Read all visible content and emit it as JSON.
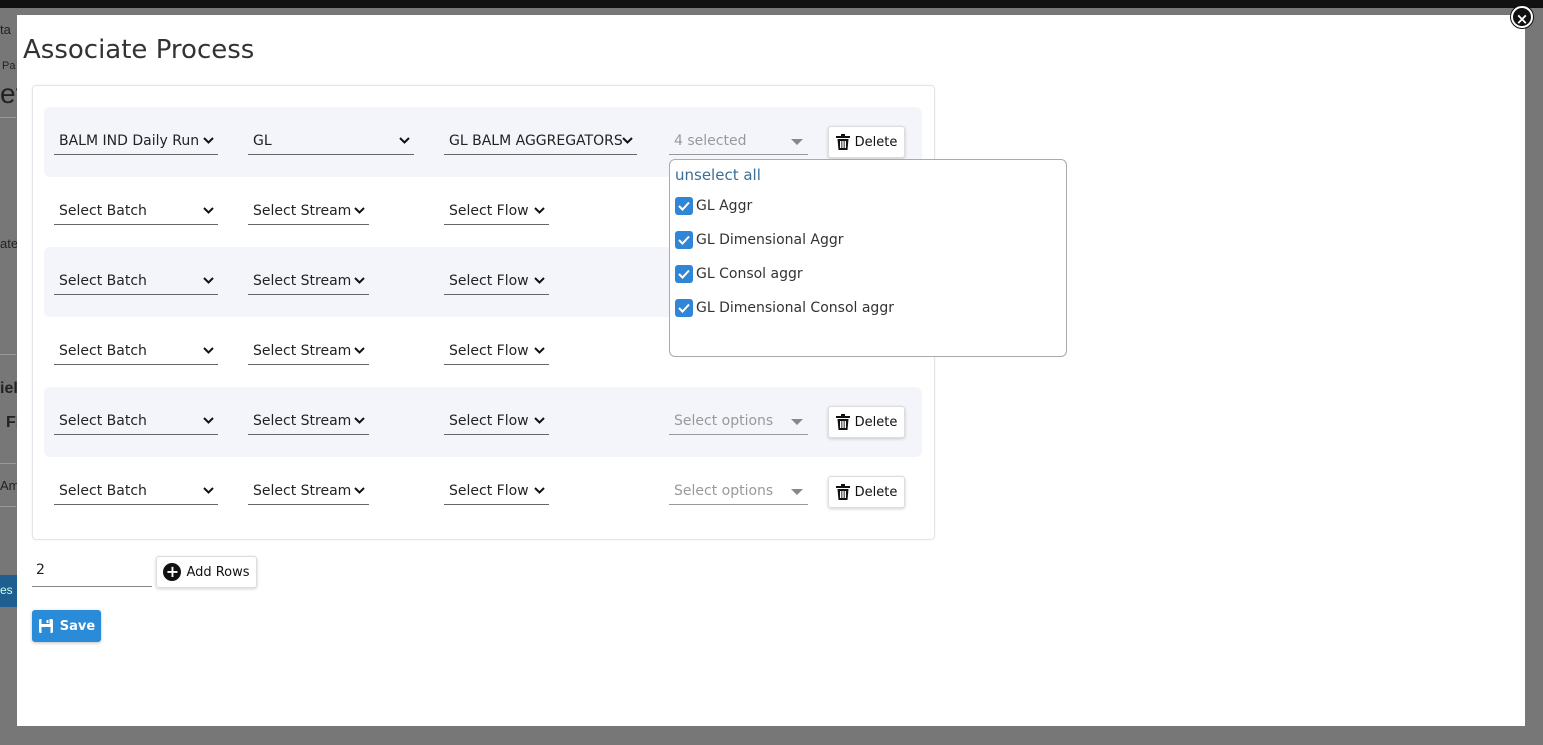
{
  "background": {
    "fragments": [
      "ta",
      "Pa",
      "ef",
      "ate",
      "iel",
      "Fi",
      "Am",
      "es"
    ]
  },
  "modal": {
    "title": "Associate Process",
    "close_icon": "close-circle-icon"
  },
  "rows": [
    {
      "batch": "BALM IND Daily Run",
      "stream": "GL",
      "flow": "GL BALM AGGREGATORS",
      "options": "4 selected",
      "delete_label": "Delete"
    },
    {
      "batch": "Select Batch",
      "stream": "Select Stream",
      "flow": "Select Flow",
      "options": "",
      "delete_label": ""
    },
    {
      "batch": "Select Batch",
      "stream": "Select Stream",
      "flow": "Select Flow",
      "options": "",
      "delete_label": ""
    },
    {
      "batch": "Select Batch",
      "stream": "Select Stream",
      "flow": "Select Flow",
      "options": "",
      "delete_label": ""
    },
    {
      "batch": "Select Batch",
      "stream": "Select Stream",
      "flow": "Select Flow",
      "options": "Select options",
      "delete_label": "Delete"
    },
    {
      "batch": "Select Batch",
      "stream": "Select Stream",
      "flow": "Select Flow",
      "options": "Select options",
      "delete_label": "Delete"
    }
  ],
  "dropdown": {
    "unselect_label": "unselect all",
    "options": [
      {
        "label": "GL Aggr",
        "checked": true
      },
      {
        "label": "GL Dimensional Aggr",
        "checked": true
      },
      {
        "label": "GL Consol aggr",
        "checked": true
      },
      {
        "label": "GL Dimensional Consol aggr",
        "checked": true
      }
    ]
  },
  "footer": {
    "rows_value": "2",
    "add_rows_label": "Add Rows",
    "save_label": "Save"
  },
  "colors": {
    "accent": "#2a8bd8",
    "row_shade": "#f3f5fb",
    "link": "#3b6e96"
  }
}
